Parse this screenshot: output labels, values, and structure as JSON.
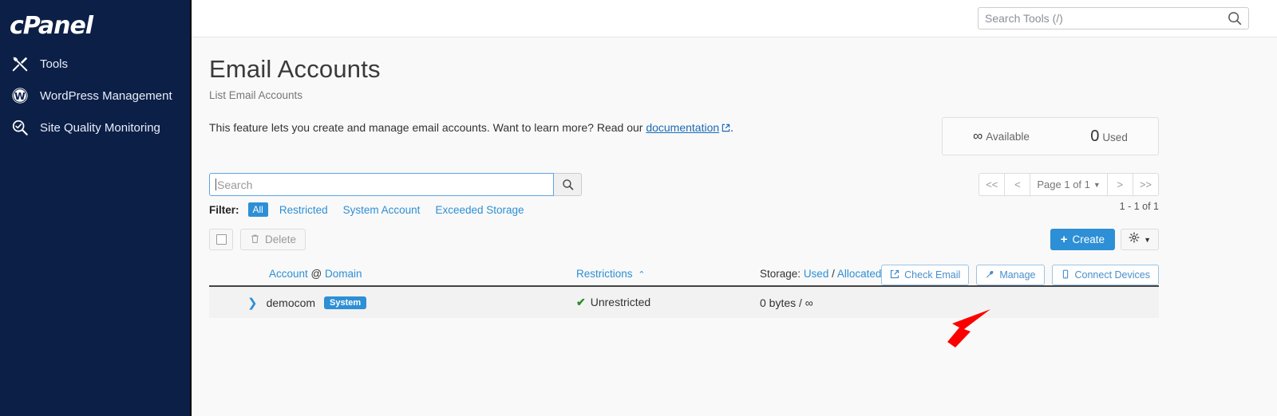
{
  "sidebar": {
    "logo": "cPanel",
    "items": [
      {
        "label": "Tools",
        "icon": "tools-icon"
      },
      {
        "label": "WordPress Management",
        "icon": "wordpress-icon"
      },
      {
        "label": "Site Quality Monitoring",
        "icon": "site-quality-icon"
      }
    ]
  },
  "topbar": {
    "search_placeholder": "Search Tools (/)",
    "search_value": "",
    "search_icon": "search-icon"
  },
  "page": {
    "title": "Email Accounts",
    "subtitle": "List Email Accounts",
    "intro_before": "This feature lets you create and manage email accounts. Want to learn more? Read our ",
    "intro_link": "documentation",
    "intro_after": "."
  },
  "stats": {
    "available_value": "∞",
    "available_label": "Available",
    "used_value": "0",
    "used_label": "Used"
  },
  "search": {
    "placeholder": "Search",
    "value": "",
    "button_icon": "search-icon"
  },
  "filter": {
    "label": "Filter:",
    "options": [
      {
        "label": "All",
        "active": true
      },
      {
        "label": "Restricted",
        "active": false
      },
      {
        "label": "System Account",
        "active": false
      },
      {
        "label": "Exceeded Storage",
        "active": false
      }
    ]
  },
  "pagination": {
    "first": "<<",
    "prev": "<",
    "page_label": "Page 1 of 1",
    "next": ">",
    "last": ">>",
    "range_text": "1 - 1 of 1"
  },
  "toolbar": {
    "select_all_name": "select-all-checkbox",
    "delete_label": "Delete",
    "create_label": "Create",
    "gear_icon": "gear-icon"
  },
  "table": {
    "headers": {
      "account": "Account",
      "at": "@",
      "domain": "Domain",
      "restrictions": "Restrictions",
      "sort_caret": "⌃",
      "storage_label": "Storage:",
      "storage_used": "Used",
      "storage_sep1": "/",
      "storage_allocated": "Allocated",
      "storage_sep2": "/",
      "storage_percent": "%"
    },
    "rows": [
      {
        "expand_icon": "chevron-right-icon",
        "account": "democom",
        "badge": "System",
        "restriction_icon": "check-icon",
        "restriction": "Unrestricted",
        "storage": "0 bytes / ∞",
        "actions": [
          {
            "label": "Check Email",
            "icon": "external-link-icon"
          },
          {
            "label": "Manage",
            "icon": "wrench-icon"
          },
          {
            "label": "Connect Devices",
            "icon": "mobile-icon"
          }
        ]
      }
    ]
  },
  "annotation": {
    "arrow_color": "#fc0000",
    "points_to": "Manage"
  },
  "colors": {
    "sidebar_bg": "#0c1f47",
    "accent_blue": "#2d8fd5",
    "link_blue": "#1b6bb5",
    "row_bg": "#f2f2f2",
    "content_bg": "#f9f9f9"
  }
}
